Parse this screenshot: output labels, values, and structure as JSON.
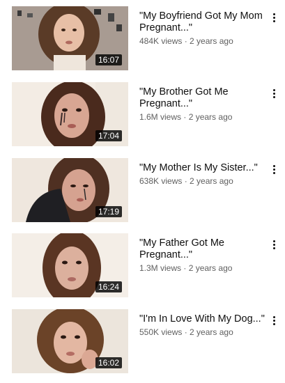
{
  "videos": [
    {
      "title": "\"My Boyfriend Got My Mom Pregnant...\"",
      "views": "484K views",
      "age": "2 years ago",
      "duration": "16:07",
      "menu_icon": "more-vert-icon"
    },
    {
      "title": "\"My Brother Got Me Pregnant...\"",
      "views": "1.6M views",
      "age": "2 years ago",
      "duration": "17:04",
      "menu_icon": "more-vert-icon"
    },
    {
      "title": "\"My Mother Is My Sister...\"",
      "views": "638K views",
      "age": "2 years ago",
      "duration": "17:19",
      "menu_icon": "more-vert-icon"
    },
    {
      "title": "\"My Father Got Me Pregnant...\"",
      "views": "1.3M views",
      "age": "2 years ago",
      "duration": "16:24",
      "menu_icon": "more-vert-icon"
    },
    {
      "title": "\"I'm In Love With My Dog...\"",
      "views": "550K views",
      "age": "2 years ago",
      "duration": "16:02",
      "menu_icon": "more-vert-icon"
    }
  ],
  "meta_separator": " · ",
  "colors": {
    "title_text": "#0f0f0f",
    "meta_text": "#606060",
    "duration_bg": "#000000",
    "duration_text": "#ffffff"
  }
}
